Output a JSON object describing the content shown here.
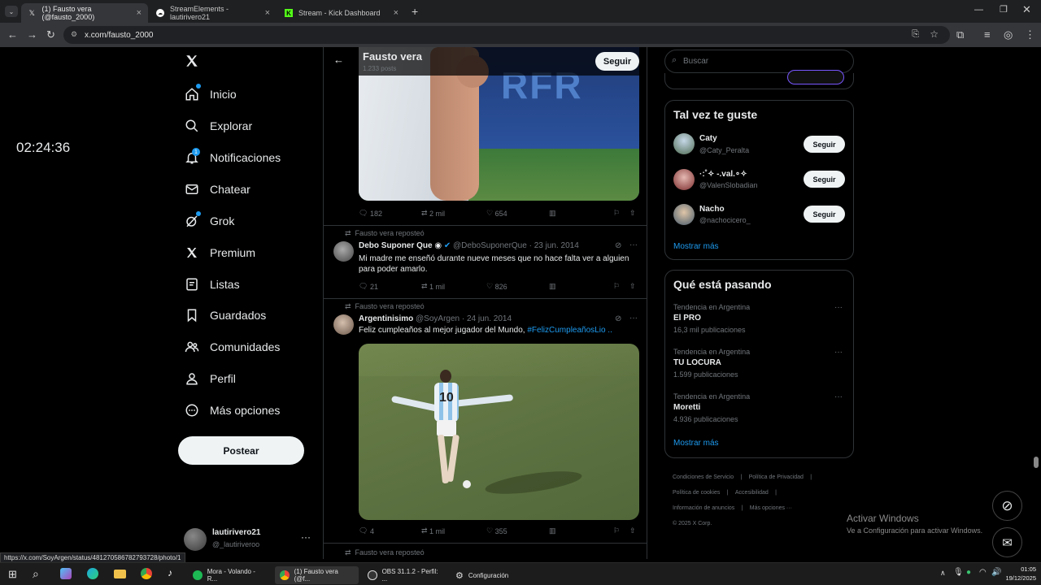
{
  "browser": {
    "tabs": [
      {
        "label": "(1) Fausto vera (@fausto_2000)",
        "icon": "x-logo"
      },
      {
        "label": "StreamElements - lautirivero21",
        "icon": "streamelements-icon"
      },
      {
        "label": "Stream - Kick Dashboard",
        "icon": "kick-icon"
      }
    ],
    "url": "x.com/fausto_2000",
    "status_url": "https://x.com/SoyArgen/status/481270586782793728/photo/1"
  },
  "clock": "02:24:36",
  "nav": {
    "items": [
      "Inicio",
      "Explorar",
      "Notificaciones",
      "Chatear",
      "Grok",
      "Premium",
      "Listas",
      "Guardados",
      "Comunidades",
      "Perfil",
      "Más opciones"
    ],
    "notif_badge": "1",
    "post_label": "Postear"
  },
  "account": {
    "name": "lautirivero21",
    "handle": "@_lautiriveroo"
  },
  "profile": {
    "name": "Fausto vera",
    "posts": "1.233 posts",
    "follow": "Seguir"
  },
  "tweets": [
    {
      "actions": {
        "replies": "182",
        "reposts": "2 mil",
        "likes": "654"
      }
    },
    {
      "repost_label": "Fausto vera reposteó",
      "name": "Debo Suponer Que",
      "handle": "@DeboSuponerQue",
      "date": "23 jun. 2014",
      "text": "Mi madre me enseñó durante nueve meses que no hace falta ver a alguien para poder amarlo.",
      "actions": {
        "replies": "21",
        "reposts": "1 mil",
        "likes": "826"
      }
    },
    {
      "repost_label": "Fausto vera reposteó",
      "name": "Argentinisimo",
      "handle": "@SoyArgen",
      "date": "24 jun. 2014",
      "text": "Feliz cumpleaños al mejor jugador del Mundo,",
      "hashtag": "#FelizCumpleañosLio ..",
      "actions": {
        "replies": "4",
        "reposts": "1 mil",
        "likes": "355"
      }
    },
    {
      "repost_label": "Fausto vera reposteó"
    }
  ],
  "search": {
    "placeholder": "Buscar"
  },
  "suggest": {
    "title": "Tal vez te guste",
    "users": [
      {
        "name": "Caty",
        "handle": "@Caty_Peralta"
      },
      {
        "name": "·:˚✧ -.val.∘✧",
        "handle": "@ValenSlobadian"
      },
      {
        "name": "Nacho",
        "handle": "@nachocicero_"
      }
    ],
    "follow": "Seguir",
    "more": "Mostrar más"
  },
  "trends": {
    "title": "Qué está pasando",
    "items": [
      {
        "meta": "Tendencia en Argentina",
        "name": "El PRO",
        "count": "16,3 mil publicaciones"
      },
      {
        "meta": "Tendencia en Argentina",
        "name": "TU LOCURA",
        "count": "1.599 publicaciones"
      },
      {
        "meta": "Tendencia en Argentina",
        "name": "Moretti",
        "count": "4.936 publicaciones"
      }
    ],
    "more": "Mostrar más"
  },
  "footer": {
    "links": [
      "Condiciones de Servicio",
      "Política de Privacidad",
      "Política de cookies",
      "Accesibilidad",
      "Información de anuncios",
      "Más opciones ···"
    ],
    "copyright": "© 2025 X Corp."
  },
  "watermark": {
    "title": "Activar Windows",
    "sub": "Ve a Configuración para activar Windows."
  },
  "taskbar": {
    "apps": [
      "Mora - Volando - R...",
      "(1) Fausto vera (@f...",
      "OBS 31.1.2 - Perfil: ...",
      "Configuración"
    ],
    "time": "01:05",
    "date": "19/12/2025"
  },
  "colors": {
    "accent": "#1d9bf0",
    "bg": "#000000",
    "border": "#2f3336",
    "muted": "#71767b"
  }
}
